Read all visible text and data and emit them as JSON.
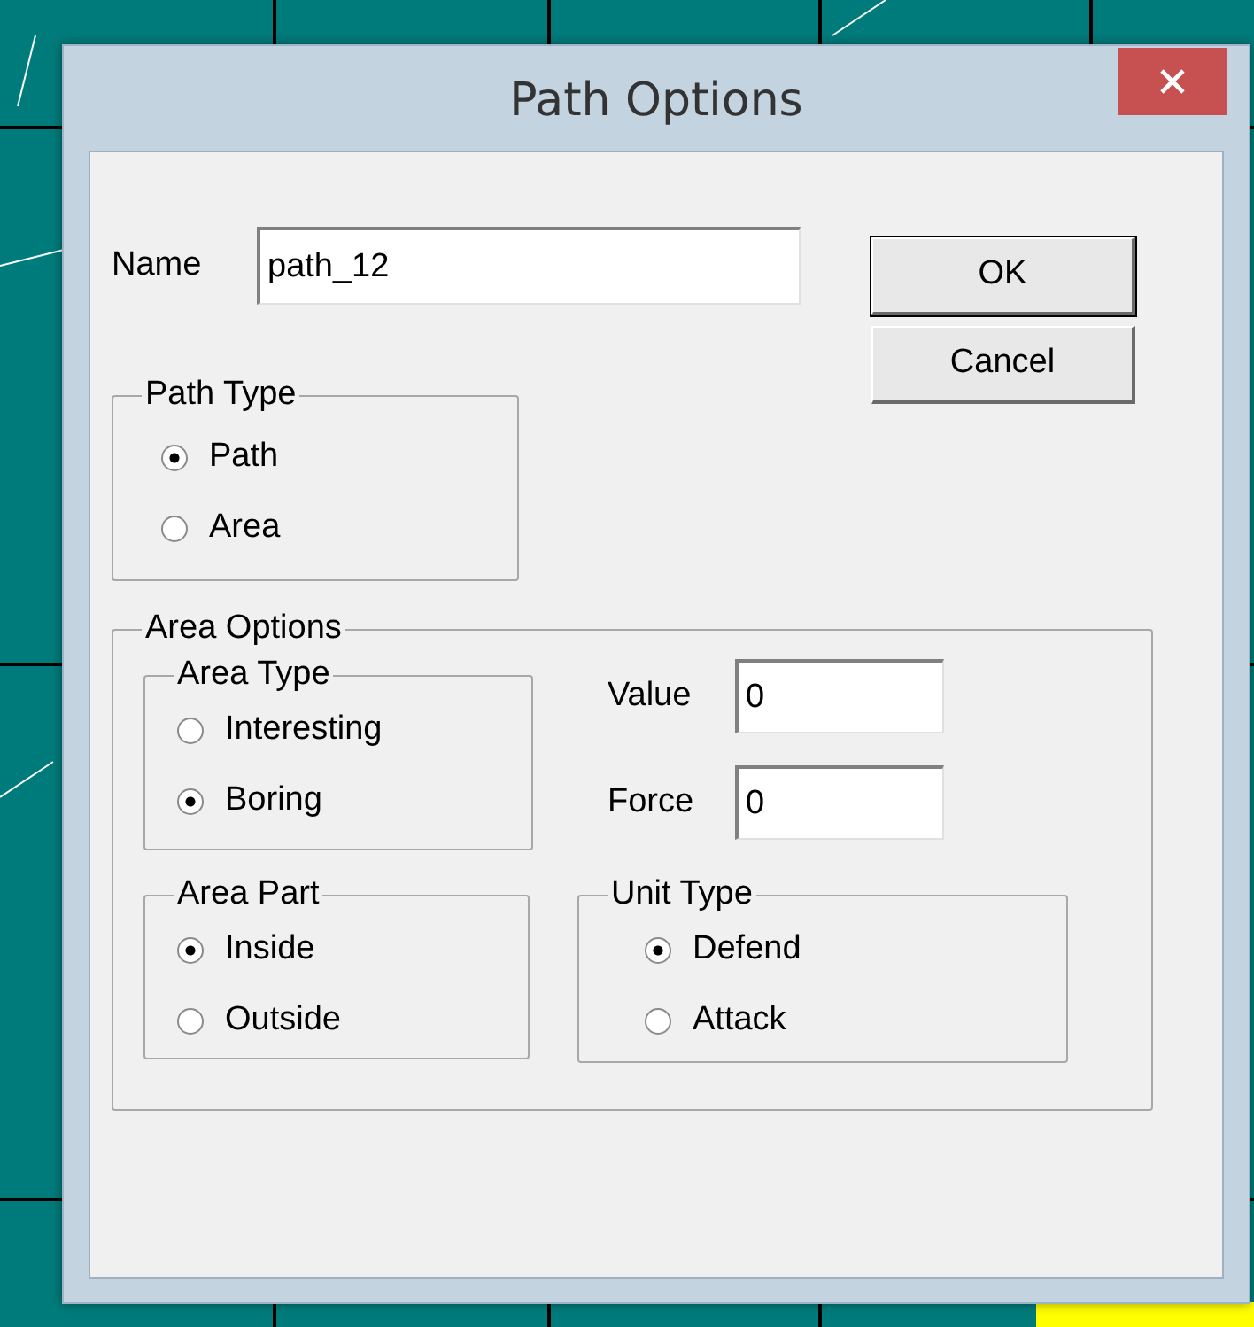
{
  "window": {
    "title": "Path Options"
  },
  "name_field": {
    "label": "Name",
    "value": "path_12"
  },
  "buttons": [
    {
      "label": "OK",
      "default": true
    },
    {
      "label": "Cancel",
      "default": false
    }
  ],
  "path_type": {
    "title": "Path Type",
    "options": [
      {
        "label": "Path",
        "selected": true
      },
      {
        "label": "Area",
        "selected": false
      }
    ]
  },
  "area_options": {
    "title": "Area Options",
    "area_type": {
      "title": "Area Type",
      "options": [
        {
          "label": "Interesting",
          "selected": false
        },
        {
          "label": "Boring",
          "selected": true
        }
      ]
    },
    "value_field": {
      "label": "Value",
      "value": "0"
    },
    "force_field": {
      "label": "Force",
      "value": "0"
    },
    "area_part": {
      "title": "Area Part",
      "options": [
        {
          "label": "Inside",
          "selected": true
        },
        {
          "label": "Outside",
          "selected": false
        }
      ]
    },
    "unit_type": {
      "title": "Unit Type",
      "options": [
        {
          "label": "Defend",
          "selected": true
        },
        {
          "label": "Attack",
          "selected": false
        }
      ]
    }
  }
}
